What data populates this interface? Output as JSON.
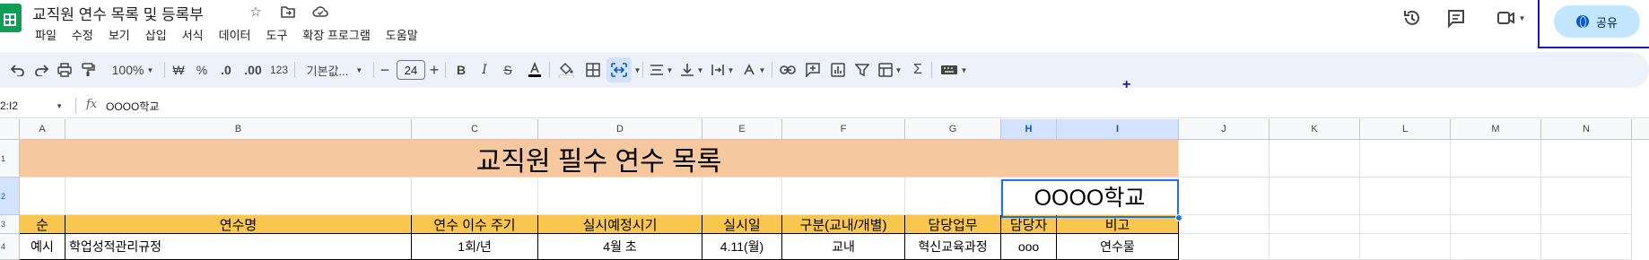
{
  "title_bar": {
    "doc_title": "교직원 연수 목록 및 등록부",
    "icons": [
      "star-icon",
      "move-folder-icon",
      "cloud-saved-icon"
    ]
  },
  "menu": [
    "파일",
    "수정",
    "보기",
    "삽입",
    "서식",
    "데이터",
    "도구",
    "확장 프로그램",
    "도움말"
  ],
  "top_right": {
    "share_label": "공유",
    "icons": [
      "history-icon",
      "comment-icon",
      "meet-icon"
    ],
    "share_color": "#c2e7ff"
  },
  "toolbar": {
    "zoom": "100%",
    "currency": "₩",
    "percent": "%",
    "decrease_decimal": ".0",
    "increase_decimal": ".00",
    "number_format": "123",
    "font_name": "기본값...",
    "font_size": "24"
  },
  "formula_bar": {
    "name_box": "2:I2",
    "fx": "fx",
    "value": "OOOO학교"
  },
  "columns": [
    "A",
    "B",
    "C",
    "D",
    "E",
    "F",
    "G",
    "H",
    "I",
    "J",
    "K",
    "L",
    "M",
    "N"
  ],
  "rows": [
    "1",
    "2",
    "3",
    "4"
  ],
  "sheet": {
    "banner_title": "교직원 필수 연수 목록",
    "school_name": "OOOO학교",
    "headers": [
      "순",
      "연수명",
      "연수 이수 주기",
      "실시예정시기",
      "실시일",
      "구분(교내/개별)",
      "담당업무",
      "담당자",
      "비고"
    ],
    "example_row": [
      "예시",
      "학업성적관리규정",
      "1회/년",
      "4월 초",
      "4.11(월)",
      "교내",
      "혁신교육과정",
      "ooo",
      "연수물"
    ]
  },
  "colors": {
    "banner_fill": "#f6c89f",
    "header_fill": "#f9c74f",
    "selection": "#1a73e8",
    "toolbar_bg": "#edf2fa"
  }
}
